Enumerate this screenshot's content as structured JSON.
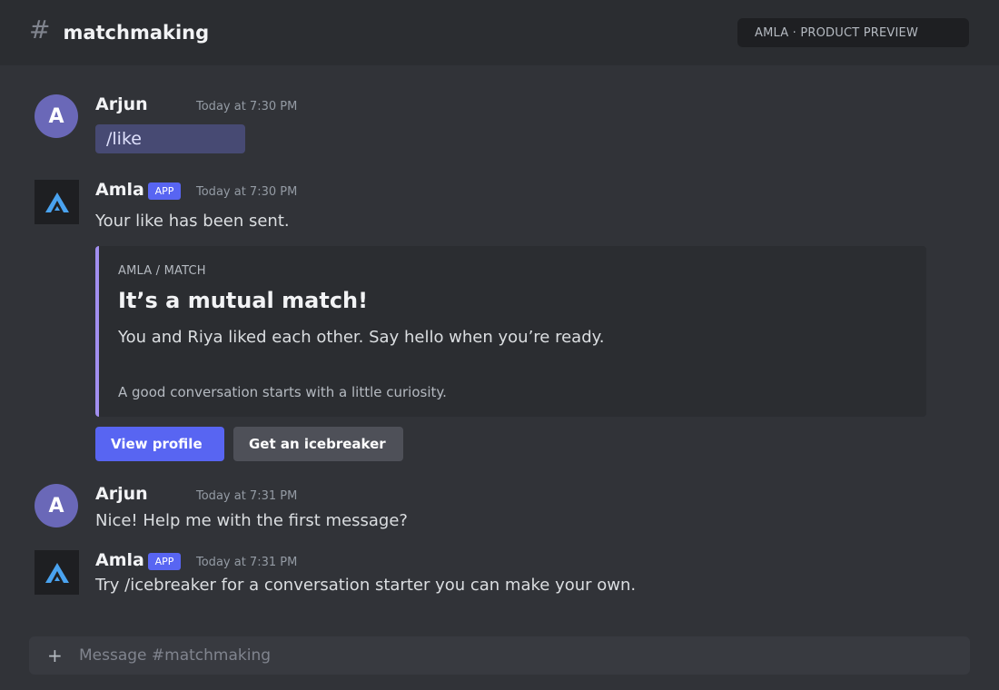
{
  "channel": {
    "hash": "#",
    "name": "matchmaking"
  },
  "preview_badge": "AMLA · PRODUCT PREVIEW",
  "colors": {
    "accent": "#5865f2",
    "embed_border": "#a28ff0",
    "avatar": "#6a68b8",
    "logo": "#4aa3f0"
  },
  "messages": [
    {
      "author": "Arjun",
      "avatar_letter": "A",
      "time": "Today at 7:30 PM",
      "command": "/like"
    },
    {
      "author": "Amla",
      "tag": "APP",
      "time": "Today at 7:30 PM",
      "text": "Your like has been sent.",
      "embed": {
        "provider": "AMLA / MATCH",
        "title": "It’s a mutual match!",
        "description": "You and Riya liked each other. Say hello when you’re ready.",
        "footer": "A good conversation starts with a little curiosity."
      },
      "buttons": {
        "view_profile": "View profile",
        "icebreaker": "Get an icebreaker"
      }
    },
    {
      "author": "Arjun",
      "avatar_letter": "A",
      "time": "Today at 7:31 PM",
      "text": "Nice! Help me with the first message?"
    },
    {
      "author": "Amla",
      "tag": "APP",
      "time": "Today at 7:31 PM",
      "text": "Try /icebreaker for a conversation starter you can make your own."
    }
  ],
  "composer": {
    "plus": "+",
    "placeholder": "Message #matchmaking"
  }
}
